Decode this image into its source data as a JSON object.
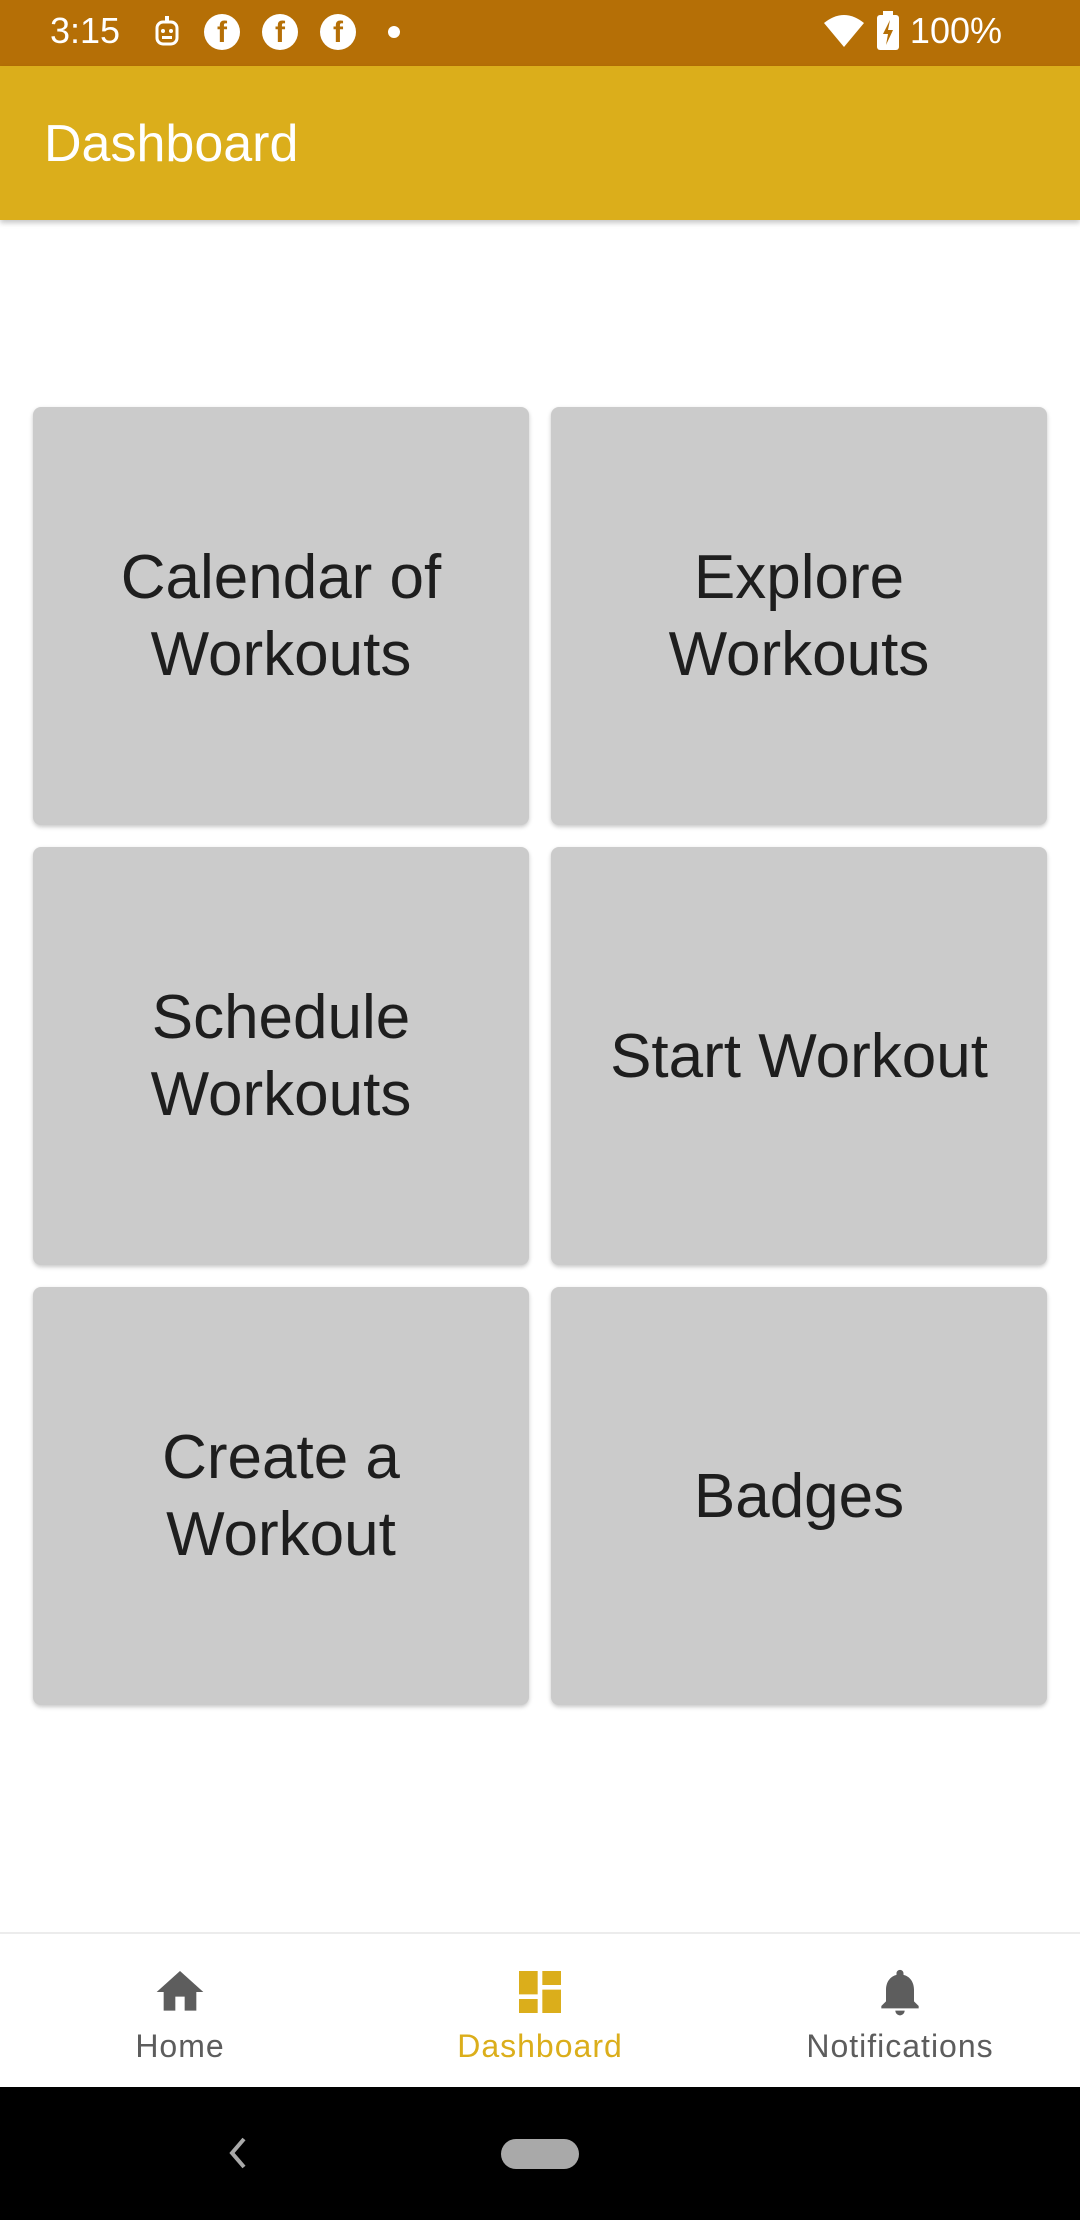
{
  "status_bar": {
    "time": "3:15",
    "battery": "100%",
    "icons_left": [
      "robot-icon",
      "facebook-icon",
      "facebook-icon",
      "facebook-icon",
      "dot-icon"
    ],
    "icons_right": [
      "wifi-icon",
      "battery-charging-icon"
    ]
  },
  "app_bar": {
    "title": "Dashboard"
  },
  "tiles": [
    {
      "label": "Calendar of Workouts"
    },
    {
      "label": "Explore Workouts"
    },
    {
      "label": "Schedule Workouts"
    },
    {
      "label": "Start Workout"
    },
    {
      "label": "Create a Workout"
    },
    {
      "label": "Badges"
    }
  ],
  "bottom_nav": {
    "items": [
      {
        "label": "Home",
        "icon": "home-icon",
        "active": false
      },
      {
        "label": "Dashboard",
        "icon": "dashboard-icon",
        "active": true
      },
      {
        "label": "Notifications",
        "icon": "bell-icon",
        "active": false
      }
    ]
  },
  "colors": {
    "status_bar": "#B56F06",
    "app_bar": "#DBAE1B",
    "tile": "#CBCBCB",
    "nav_active": "#DBAE1B",
    "nav_inactive": "#5d5d5d"
  }
}
